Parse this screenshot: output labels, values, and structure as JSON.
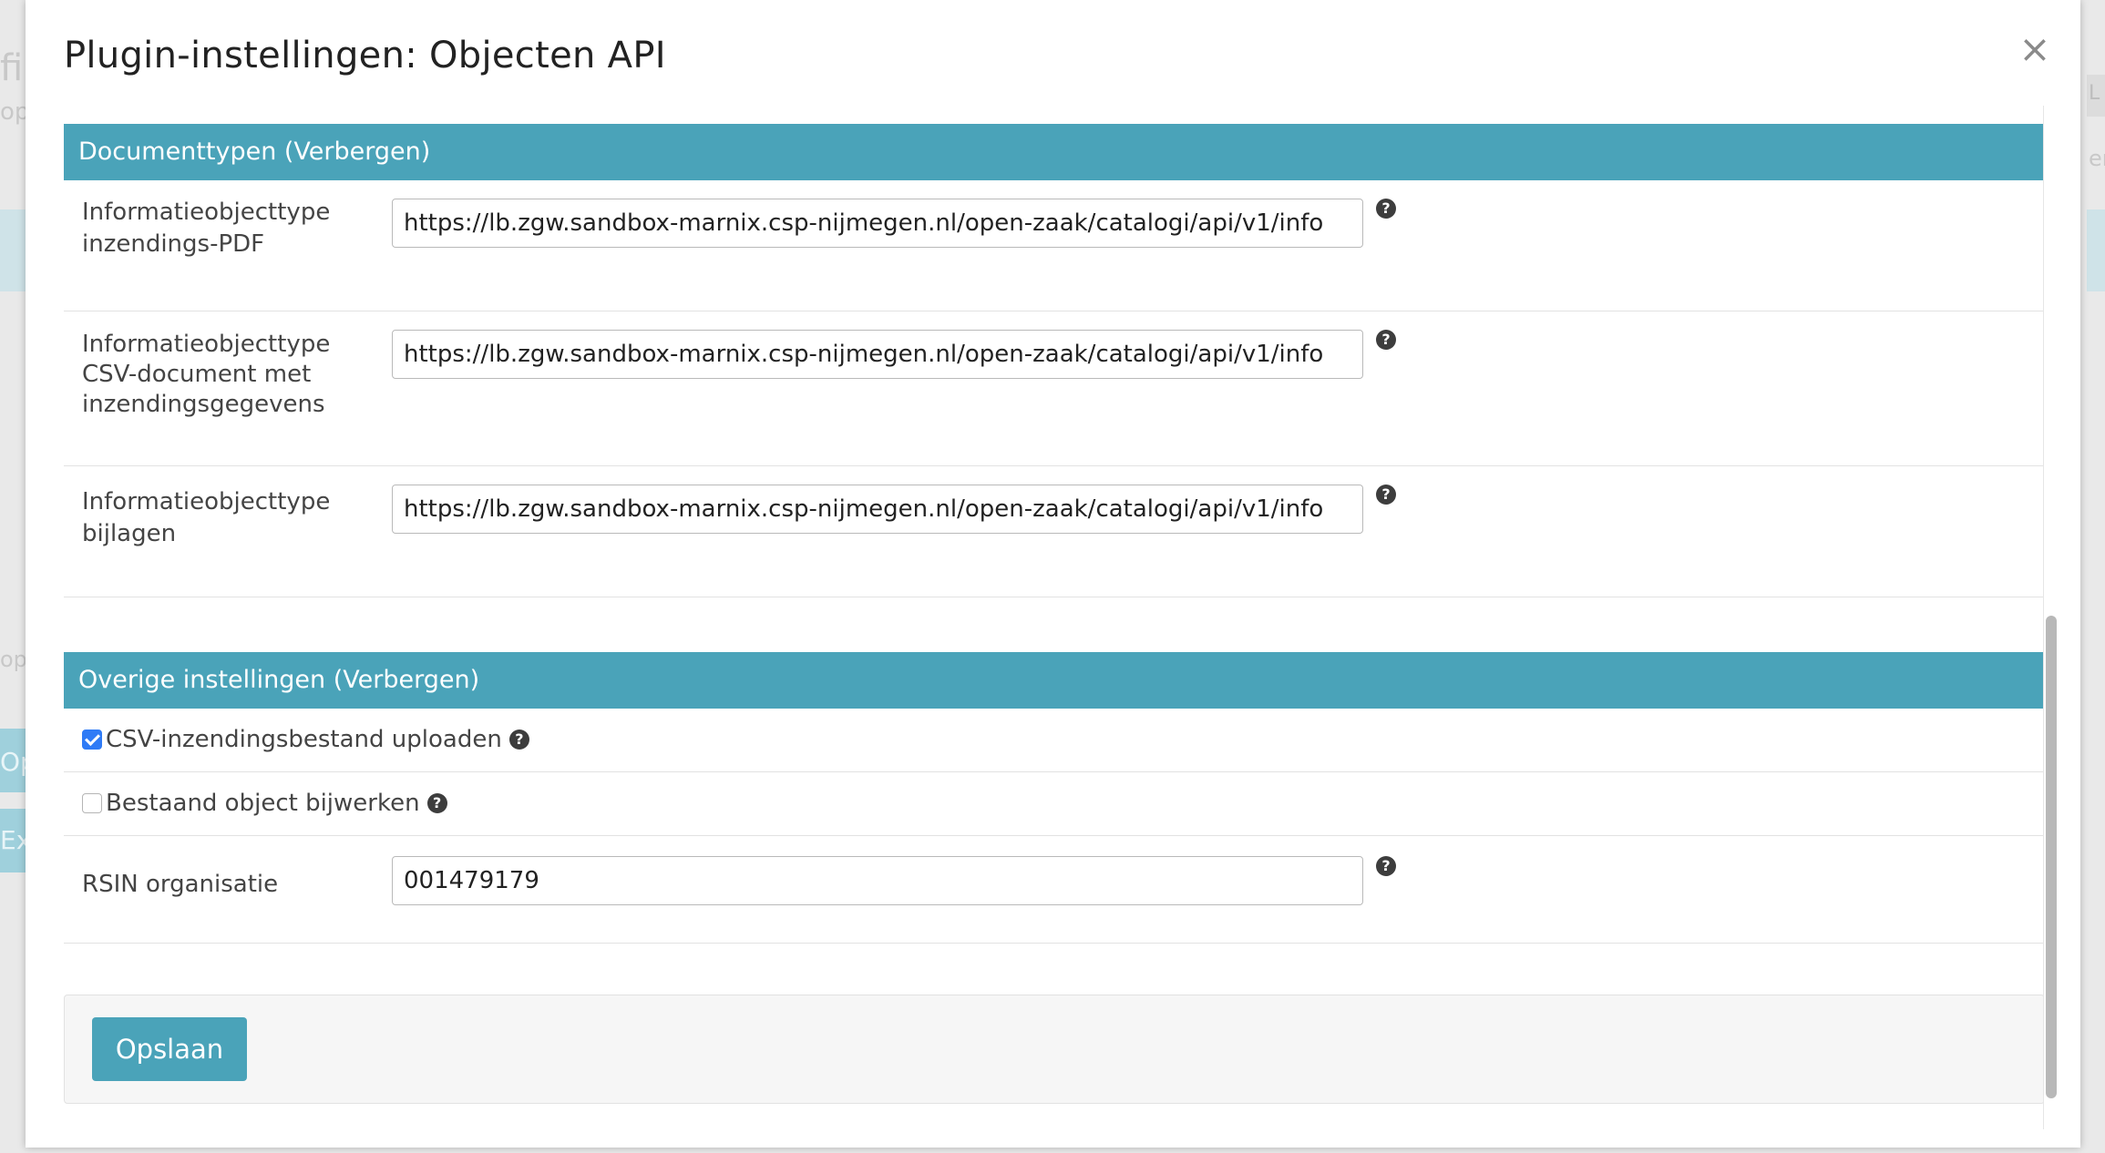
{
  "modal": {
    "title": "Plugin-instellingen: Objecten API",
    "close_symbol": "×"
  },
  "sections": {
    "documenttypen": {
      "header": "Documenttypen (Verbergen)",
      "fields": [
        {
          "label": "Informatieobjecttype inzendings-PDF",
          "value": "https://lb.zgw.sandbox-marnix.csp-nijmegen.nl/open-zaak/catalogi/api/v1/info"
        },
        {
          "label": "Informatieobjecttype CSV-document met inzendingsgegevens",
          "value": "https://lb.zgw.sandbox-marnix.csp-nijmegen.nl/open-zaak/catalogi/api/v1/info"
        },
        {
          "label": "Informatieobjecttype bijlagen",
          "value": "https://lb.zgw.sandbox-marnix.csp-nijmegen.nl/open-zaak/catalogi/api/v1/info"
        }
      ]
    },
    "overige": {
      "header": "Overige instellingen (Verbergen)",
      "checkboxes": [
        {
          "label": "CSV-inzendingsbestand uploaden",
          "checked": true
        },
        {
          "label": "Bestaand object bijwerken",
          "checked": false
        }
      ],
      "rsin": {
        "label": "RSIN organisatie",
        "value": "001479179"
      }
    }
  },
  "footer": {
    "save_label": "Opslaan"
  },
  "help_icon_glyph": "?",
  "background_fragments": [
    "fi",
    "op",
    "op",
    "Op",
    "Ex",
    "L",
    "er"
  ],
  "colors": {
    "accent": "#4aa3b9",
    "checkbox_checked": "#2f7bf6",
    "text": "#444444"
  }
}
